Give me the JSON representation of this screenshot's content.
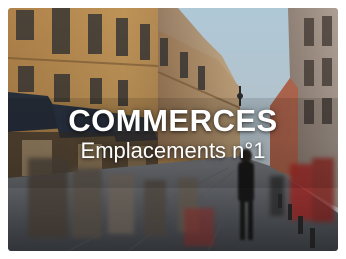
{
  "tile": {
    "title": "COMMERCES",
    "subtitle": "Emplacements n°1"
  },
  "colors": {
    "text": "#ffffff",
    "facade_warm": "#c99a5a",
    "sky": "#cfe0ea",
    "street": "#5a5f66",
    "awning": "#2b3442",
    "accent_red": "#c2332d"
  }
}
